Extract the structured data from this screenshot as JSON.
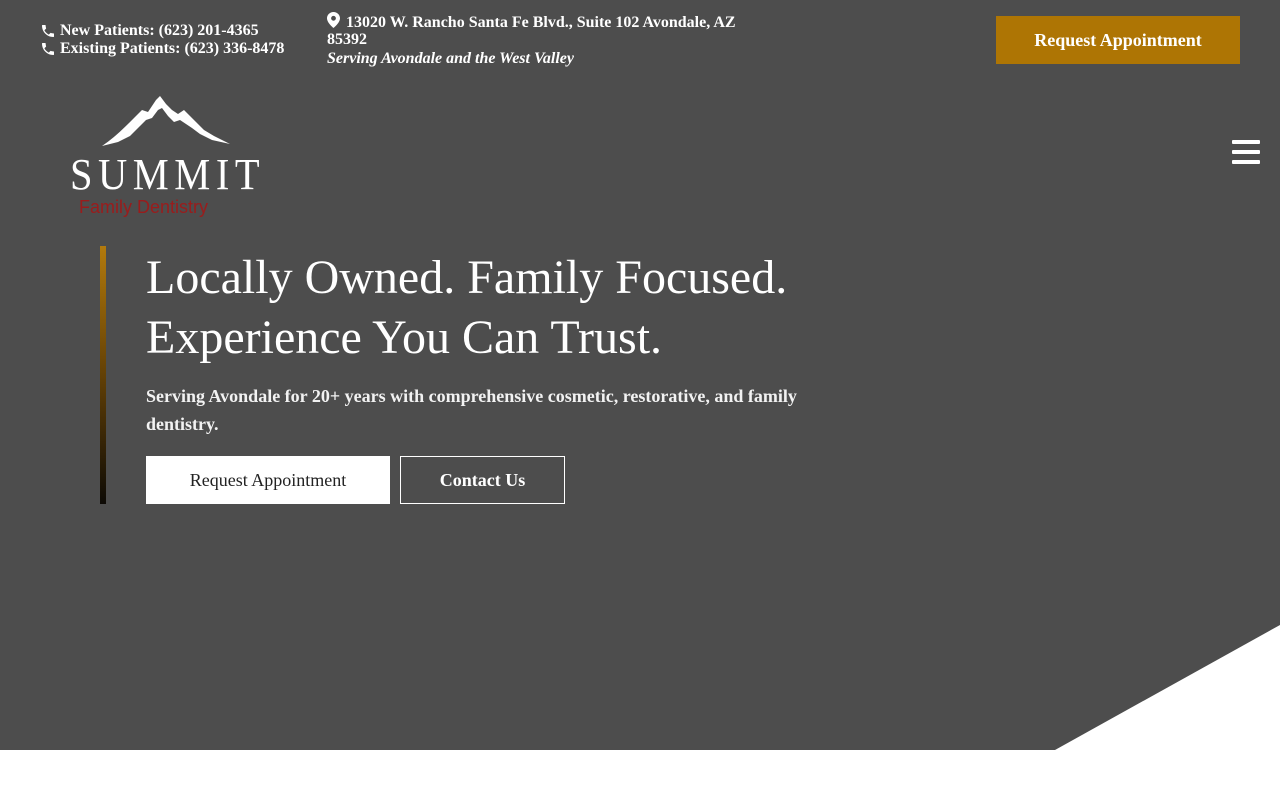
{
  "header": {
    "new_patients": "New Patients: (623) 201-4365",
    "existing_patients": "Existing Patients: (623) 336-8478",
    "address": "13020 W. Rancho Santa Fe Blvd., Suite 102 Avondale, AZ 85392",
    "service_area": "Serving Avondale and the West Valley",
    "request_button": "Request Appointment",
    "icons": {
      "phone": "phone-icon",
      "location": "map-pin-icon",
      "menu": "hamburger-menu-icon"
    }
  },
  "logo": {
    "name": "SUMMIT",
    "subtitle": "Family Dentistry"
  },
  "hero": {
    "headline_line1": "Locally Owned. Family Focused.",
    "headline_line2": "Experience You Can Trust.",
    "subtext": "Serving Avondale for 20+ years with comprehensive cosmetic, restorative, and family dentistry.",
    "primary_button": "Request Appointment",
    "secondary_button": "Contact Us"
  },
  "colors": {
    "hero_background": "#4d4d4d",
    "accent_gold": "#ae7504",
    "logo_subtitle_red": "#9a1c1c",
    "white": "#ffffff"
  }
}
